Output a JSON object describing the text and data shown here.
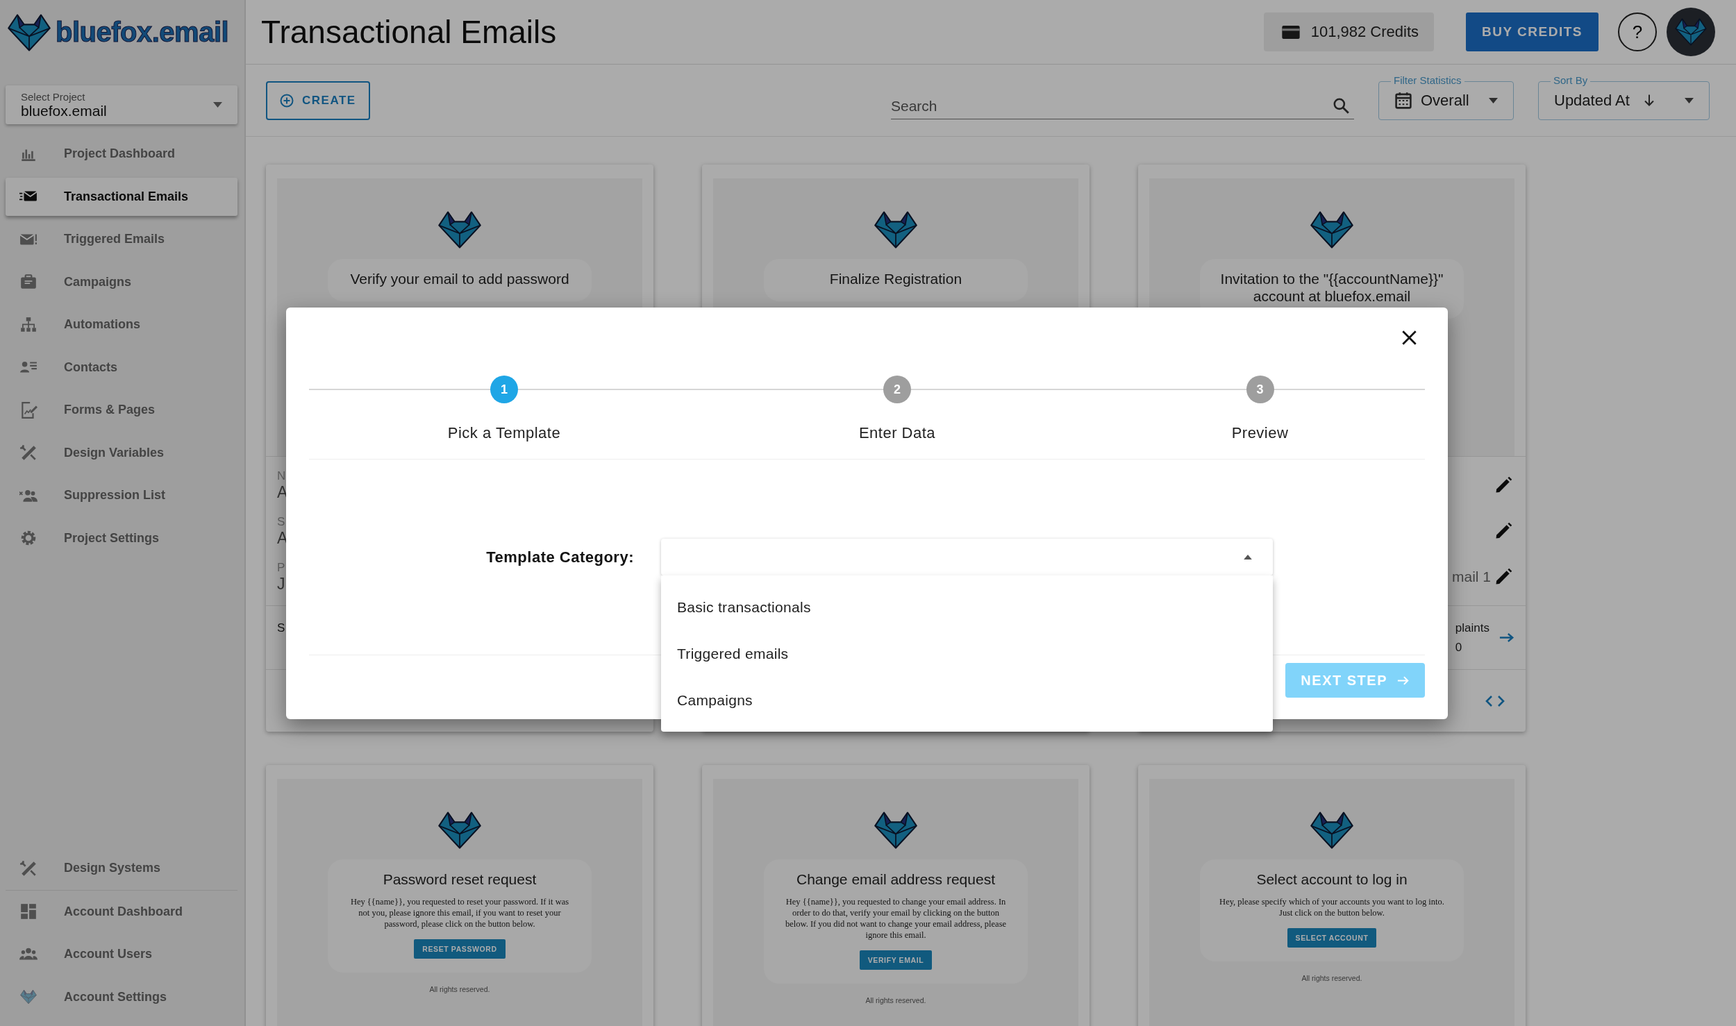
{
  "brand": {
    "name": "bluefox.email"
  },
  "header": {
    "title": "Transactional Emails",
    "credits": "101,982 Credits",
    "buy_button": "BUY CREDITS",
    "help_button": "?"
  },
  "sidebar": {
    "project_select": {
      "label": "Select Project",
      "value": "bluefox.email"
    },
    "items": [
      {
        "label": "Project Dashboard",
        "selected": false
      },
      {
        "label": "Transactional Emails",
        "selected": true
      },
      {
        "label": "Triggered Emails",
        "selected": false
      },
      {
        "label": "Campaigns",
        "selected": false
      },
      {
        "label": "Automations",
        "selected": false
      },
      {
        "label": "Contacts",
        "selected": false
      },
      {
        "label": "Forms & Pages",
        "selected": false
      },
      {
        "label": "Design Variables",
        "selected": false
      },
      {
        "label": "Suppression List",
        "selected": false
      },
      {
        "label": "Project Settings",
        "selected": false
      }
    ],
    "bottom_items": [
      {
        "label": "Design Systems",
        "selected": false
      },
      {
        "label": "Account Dashboard",
        "selected": false
      },
      {
        "label": "Account Users",
        "selected": false
      },
      {
        "label": "Account Settings",
        "selected": false
      }
    ]
  },
  "toolbar": {
    "create_button": "CREATE",
    "search": {
      "placeholder": "Search"
    },
    "filter": {
      "label": "Filter Statistics",
      "value": "Overall"
    },
    "sort": {
      "label": "Sort By",
      "value": "Updated At"
    }
  },
  "cards": [
    {
      "preview": {
        "title": "Verify your email to add password"
      },
      "details": [
        {
          "label": "N",
          "value": "A"
        },
        {
          "label": "S",
          "value": "A"
        },
        {
          "label": "P",
          "value": "J"
        }
      ],
      "stats": {
        "label": "S"
      }
    },
    {
      "preview": {
        "title": "Finalize Registration"
      }
    },
    {
      "preview": {
        "title": "Invitation to the \"{{accountName}}\" account at bluefox.email"
      },
      "details": [
        {
          "edit": true
        },
        {
          "edit": true
        },
        {
          "tail": "mail 1",
          "edit": true
        }
      ],
      "stats": {
        "tail_label": "plaints",
        "tail_value": "0",
        "open_arrow": true
      },
      "code_view": true
    },
    {
      "preview": {
        "title": "Password reset request",
        "body": "Hey {{name}}, you requested to reset your password. If it was not you, please ignore this email, if you want to reset your password, please click on the button below.",
        "button": "RESET PASSWORD",
        "footer": "All rights reserved."
      }
    },
    {
      "preview": {
        "title": "Change email address request",
        "body": "Hey {{name}}, you requested to change your email address. In order to do that, verify your email by clicking on the button below. If you did not want to change your email address, please ignore this email.",
        "button": "VERIFY EMAIL",
        "footer": "All rights reserved."
      }
    },
    {
      "preview": {
        "title": "Select account to log in",
        "body": "Hey, please specify which of your accounts you want to log into. Just click on the button below.",
        "button": "SELECT ACCOUNT",
        "footer": "All rights reserved."
      }
    }
  ],
  "dialog": {
    "steps": [
      {
        "number": "1",
        "label": "Pick a Template",
        "active": true
      },
      {
        "number": "2",
        "label": "Enter Data",
        "active": false
      },
      {
        "number": "3",
        "label": "Preview",
        "active": false
      }
    ],
    "field_label": "Template Category:",
    "dropdown": {
      "expanded": true,
      "options": [
        {
          "label": "Basic transactionals",
          "selected": false
        },
        {
          "label": "Triggered emails",
          "selected": false
        },
        {
          "label": "Campaigns",
          "selected": false
        }
      ]
    },
    "next_button": {
      "label": "NEXT STEP",
      "disabled": true
    }
  }
}
